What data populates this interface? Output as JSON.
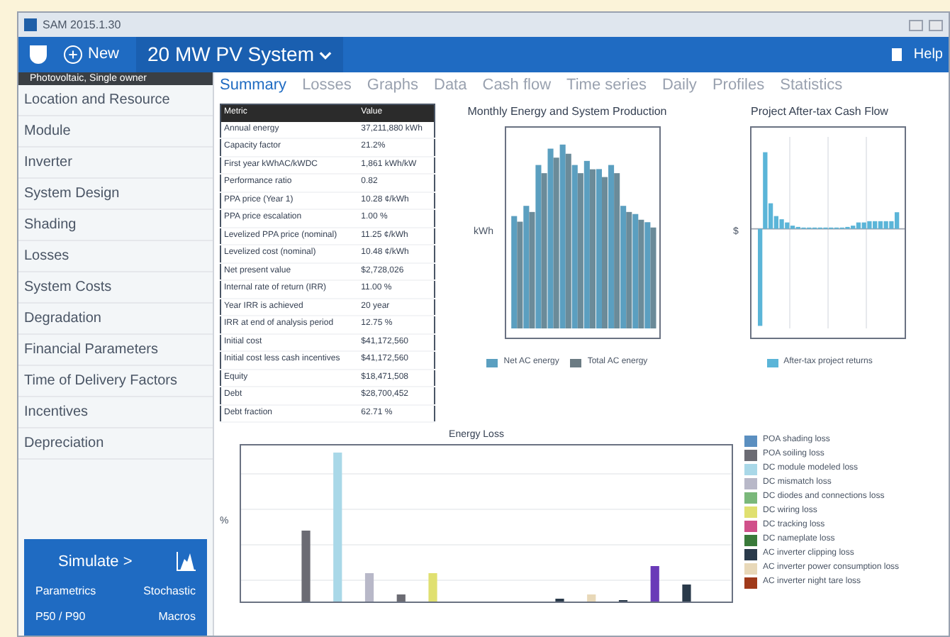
{
  "window": {
    "title": "SAM 2015.1.30"
  },
  "toolbar": {
    "new_label": "New",
    "case_name": "20 MW PV System",
    "help_label": "Help"
  },
  "sidebar": {
    "config_label": "Photovoltaic, Single owner",
    "items": [
      {
        "label": "Location and Resource",
        "selected": false
      },
      {
        "label": "Module",
        "selected": false
      },
      {
        "label": "Inverter",
        "selected": false
      },
      {
        "label": "System Design",
        "selected": false
      },
      {
        "label": "Shading",
        "selected": false
      },
      {
        "label": "Losses",
        "selected": false
      },
      {
        "label": "System Costs",
        "selected": false
      },
      {
        "label": "Degradation",
        "selected": false
      },
      {
        "label": "Financial Parameters",
        "selected": false
      },
      {
        "label": "Time of Delivery Factors",
        "selected": false
      },
      {
        "label": "Incentives",
        "selected": false
      },
      {
        "label": "Depreciation",
        "selected": false
      }
    ],
    "simulate": {
      "label": "Simulate >",
      "links": [
        "Parametrics",
        "Stochastic",
        "P50 / P90",
        "Macros"
      ]
    }
  },
  "tabs": [
    {
      "label": "Summary",
      "selected": true
    },
    {
      "label": "Losses",
      "selected": false
    },
    {
      "label": "Graphs",
      "selected": false
    },
    {
      "label": "Data",
      "selected": false
    },
    {
      "label": "Cash flow",
      "selected": false
    },
    {
      "label": "Time series",
      "selected": false
    },
    {
      "label": "Daily",
      "selected": false
    },
    {
      "label": "Profiles",
      "selected": false
    },
    {
      "label": "Statistics",
      "selected": false
    }
  ],
  "table": {
    "columns": [
      "Metric",
      "Value"
    ],
    "rows": [
      [
        "Annual energy",
        "37,211,880 kWh"
      ],
      [
        "Capacity factor",
        "21.2%"
      ],
      [
        "First year kWhAC/kWDC",
        "1,861 kWh/kW"
      ],
      [
        "Performance ratio",
        "0.82"
      ],
      [
        "PPA price (Year 1)",
        "10.28 ¢/kWh"
      ],
      [
        "PPA price escalation",
        "1.00 %"
      ],
      [
        "Levelized PPA price (nominal)",
        "11.25 ¢/kWh"
      ],
      [
        "Levelized cost (nominal)",
        "10.48 ¢/kWh"
      ],
      [
        "Net present value",
        "$2,728,026"
      ],
      [
        "Internal rate of return (IRR)",
        "11.00 %"
      ],
      [
        "Year IRR is achieved",
        "20 year"
      ],
      [
        "IRR at end of analysis period",
        "12.75 %"
      ],
      [
        "Initial cost",
        "$41,172,560"
      ],
      [
        "Initial cost less cash incentives",
        "$41,172,560"
      ],
      [
        "Equity",
        "$18,471,508"
      ],
      [
        "Debt",
        "$28,700,452"
      ],
      [
        "Debt fraction",
        "62.71 %"
      ]
    ]
  },
  "monthly_chart": {
    "title": "Monthly Energy and System Production",
    "ylabel": "kWh",
    "legend": [
      {
        "label": "Net AC energy",
        "color": "#5b9fc0"
      },
      {
        "label": "Total AC energy",
        "color": "#6b7b83"
      }
    ]
  },
  "cashflow_chart": {
    "title": "Project After-tax Cash Flow",
    "ylabel": "$",
    "legend": [
      {
        "label": "After-tax project returns",
        "color": "#5bb5d8"
      }
    ]
  },
  "loss_chart": {
    "title": "Energy Loss",
    "ylabel": "%",
    "legend": [
      {
        "label": "POA shading loss",
        "color": "#5b8fc0"
      },
      {
        "label": "POA soiling loss",
        "color": "#6b6b73"
      },
      {
        "label": "DC module modeled loss",
        "color": "#a9d8e8"
      },
      {
        "label": "DC mismatch loss",
        "color": "#b8b8c8"
      },
      {
        "label": "DC diodes and connections loss",
        "color": "#7ab87a"
      },
      {
        "label": "DC wiring loss",
        "color": "#e0e070"
      },
      {
        "label": "DC tracking loss",
        "color": "#d0508a"
      },
      {
        "label": "DC nameplate loss",
        "color": "#3a7a3a"
      },
      {
        "label": "AC inverter clipping loss",
        "color": "#2a3a4a"
      },
      {
        "label": "AC inverter power consumption loss",
        "color": "#e8d8b8"
      },
      {
        "label": "AC inverter night tare loss",
        "color": "#a03a1a"
      }
    ]
  }
}
